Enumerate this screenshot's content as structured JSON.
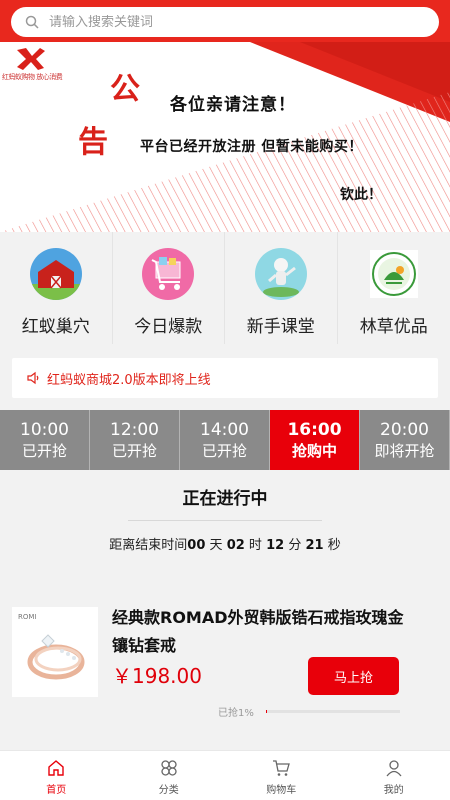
{
  "search": {
    "placeholder": "请输入搜索关键词"
  },
  "banner": {
    "logo_text": "红蚂蚁购物 放心消费",
    "char1": "公",
    "char2": "告",
    "line1": "各位亲请注意！",
    "line2": "平台已经开放注册  但暂未能购买！",
    "line3": "钦此！"
  },
  "categories": [
    {
      "label": "红蚁巢穴",
      "icon": "barn-image"
    },
    {
      "label": "今日爆款",
      "icon": "shopping-cart-image"
    },
    {
      "label": "新手课堂",
      "icon": "figure-image"
    },
    {
      "label": "林草优品",
      "icon": "green-badge-image"
    }
  ],
  "notice": {
    "text": "红蚂蚁商城2.0版本即将上线",
    "icon": "speaker-icon"
  },
  "time_slots": [
    {
      "time": "10:00",
      "status": "已开抢"
    },
    {
      "time": "12:00",
      "status": "已开抢"
    },
    {
      "time": "14:00",
      "status": "已开抢"
    },
    {
      "time": "16:00",
      "status": "抢购中"
    },
    {
      "time": "20:00",
      "status": "即将开抢"
    }
  ],
  "ongoing": {
    "title": "正在进行中",
    "countdown_prefix": "距离结束时间",
    "days": "00",
    "day_unit": "天",
    "hours": "02",
    "hour_unit": "时",
    "minutes": "12",
    "minute_unit": "分",
    "seconds": "21",
    "second_unit": "秒"
  },
  "product": {
    "name": "经典款ROMAD外贸韩版锆石戒指玫瑰金镶钻套戒",
    "price": "￥198.00",
    "buy_label": "马上抢",
    "sold_label": "已抢1%",
    "sold_percent": 1,
    "brand_mark": "ROMI"
  },
  "nav": [
    {
      "label": "首页",
      "icon": "home-icon",
      "active": true
    },
    {
      "label": "分类",
      "icon": "category-icon",
      "active": false
    },
    {
      "label": "购物车",
      "icon": "cart-icon",
      "active": false
    },
    {
      "label": "我的",
      "icon": "user-icon",
      "active": false
    }
  ],
  "colors": {
    "brand_red": "#e8000a",
    "inactive_tab": "#8a8a8a"
  }
}
